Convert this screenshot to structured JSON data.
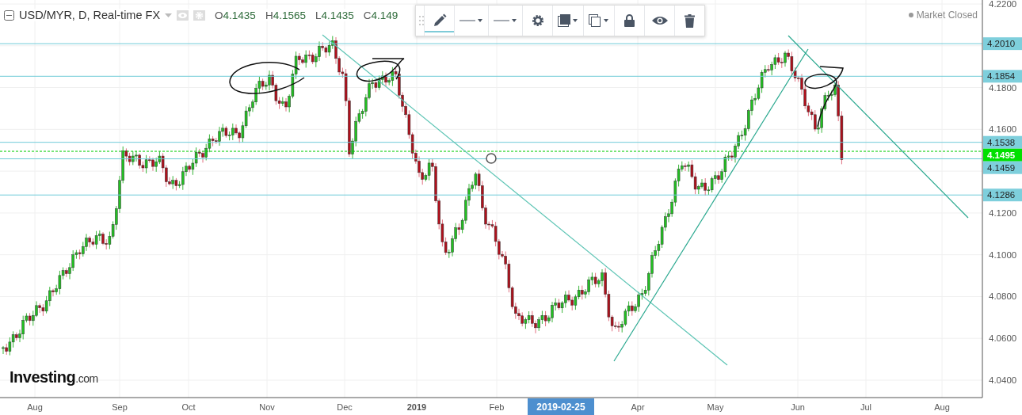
{
  "header": {
    "title": "USD/MYR, D, Real-time FX",
    "ohlc": [
      {
        "key": "O",
        "value": "4.1435"
      },
      {
        "key": "H",
        "value": "4.1565"
      },
      {
        "key": "L",
        "value": "4.1435"
      },
      {
        "key": "C",
        "value": "4.149"
      }
    ]
  },
  "toolbar": {
    "tools": [
      {
        "kind": "pencil",
        "selected": true
      },
      {
        "kind": "line-style",
        "selected": false
      },
      {
        "kind": "line-width",
        "selected": false
      },
      {
        "kind": "settings",
        "selected": false
      },
      {
        "kind": "fill",
        "selected": false
      },
      {
        "kind": "clone",
        "selected": false
      },
      {
        "kind": "lock",
        "selected": false
      },
      {
        "kind": "visibility",
        "selected": false
      },
      {
        "kind": "delete",
        "selected": false
      }
    ]
  },
  "market_status": "Market Closed",
  "price_axis": {
    "ticks": [
      "4.2200",
      "4.1800",
      "4.1600",
      "4.1200",
      "4.1000",
      "4.0800",
      "4.0600",
      "4.0400"
    ]
  },
  "price_levels": [
    {
      "label": "4.2010",
      "kind": "level"
    },
    {
      "label": "4.1854",
      "kind": "level"
    },
    {
      "label": "4.1538",
      "kind": "level"
    },
    {
      "label": "4.1495",
      "kind": "current"
    },
    {
      "label": "4.1459",
      "kind": "level"
    },
    {
      "label": "4.1286",
      "kind": "level"
    }
  ],
  "time_axis": {
    "labels": [
      {
        "label": "Aug",
        "bold": false
      },
      {
        "label": "Sep",
        "bold": false
      },
      {
        "label": "Oct",
        "bold": false
      },
      {
        "label": "Nov",
        "bold": false
      },
      {
        "label": "Dec",
        "bold": false
      },
      {
        "label": "2019",
        "bold": true
      },
      {
        "label": "Feb",
        "bold": false
      },
      {
        "label": "Apr",
        "bold": false
      },
      {
        "label": "May",
        "bold": false
      },
      {
        "label": "Jun",
        "bold": false
      },
      {
        "label": "Jul",
        "bold": false
      },
      {
        "label": "Aug",
        "bold": false
      }
    ],
    "cursor_label": "2019-02-25"
  },
  "logo": {
    "name": "Investing",
    "suffix": ".com"
  }
}
